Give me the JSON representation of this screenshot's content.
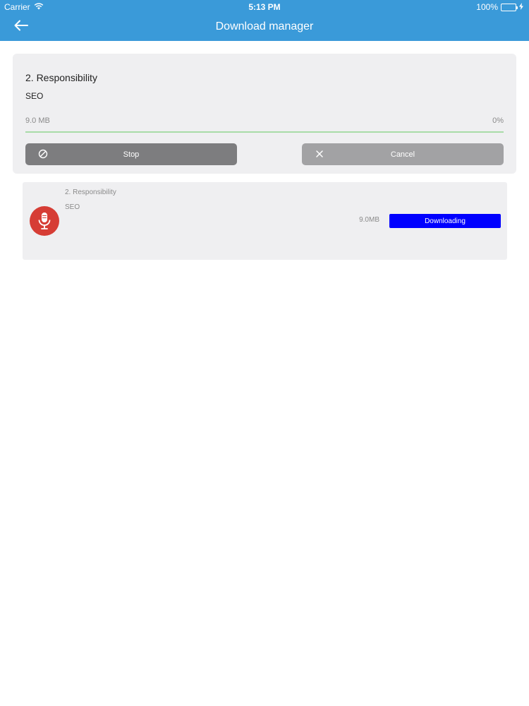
{
  "status_bar": {
    "carrier": "Carrier",
    "time": "5:13 PM",
    "battery": "100%"
  },
  "nav": {
    "title": "Download manager",
    "back_icon": "arrow-left-icon"
  },
  "active_download": {
    "title": "2. Responsibility",
    "subtitle": "SEO",
    "size": "9.0 MB",
    "progress_label": "0%",
    "progress": 0,
    "stop_label": "Stop",
    "cancel_label": "Cancel",
    "stop_icon": "no-entry-icon",
    "cancel_icon": "close-icon"
  },
  "downloads": [
    {
      "title": "2. Responsibility",
      "subtitle": "SEO",
      "size": "9.0MB",
      "status": "Downloading",
      "icon": "microphone-icon"
    }
  ],
  "colors": {
    "header": "#3a9ad9",
    "progress": "#4caf50",
    "status_badge": "#0000ff",
    "avatar": "#d63d35"
  }
}
